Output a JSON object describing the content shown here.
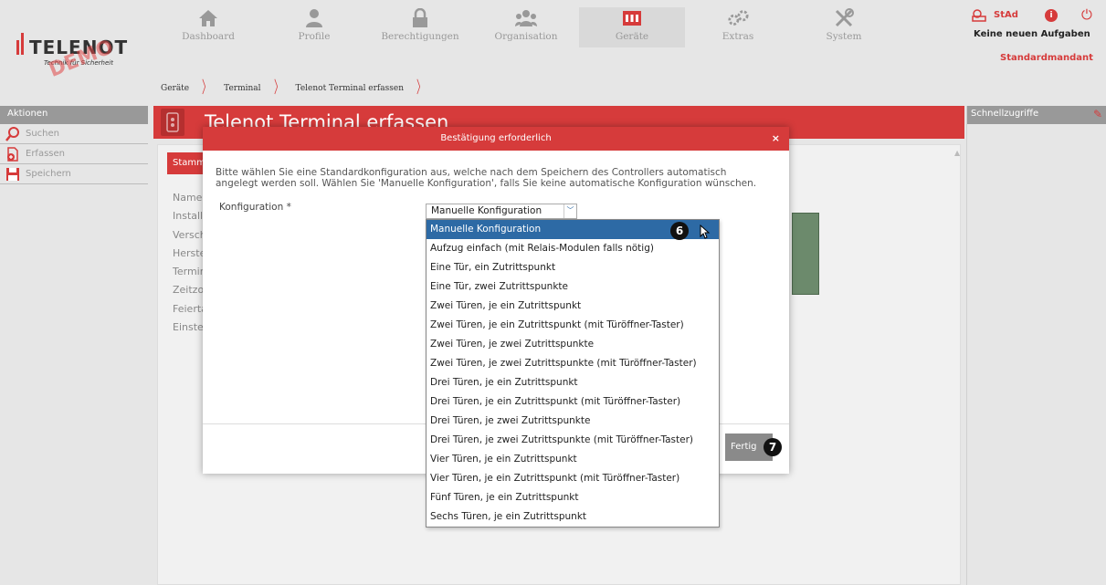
{
  "header": {
    "logo_text": "TELENOT",
    "logo_tagline": "Technik für Sicherheit",
    "logo_watermark": "DEMO",
    "nav": [
      {
        "label": "Dashboard",
        "icon": "house-icon"
      },
      {
        "label": "Profile",
        "icon": "person-icon"
      },
      {
        "label": "Berechtigungen",
        "icon": "lock-icon"
      },
      {
        "label": "Organisation",
        "icon": "group-icon"
      },
      {
        "label": "Geräte",
        "icon": "device-icon",
        "active": true
      },
      {
        "label": "Extras",
        "icon": "gears-icon"
      },
      {
        "label": "System",
        "icon": "tools-icon"
      }
    ],
    "user": "StAd",
    "tasks": "Keine neuen Aufgaben",
    "mandant": "Standardmandant"
  },
  "breadcrumb": [
    "Geräte",
    "Terminal",
    "Telenot Terminal erfassen"
  ],
  "sidebar": {
    "title": "Aktionen",
    "items": [
      {
        "label": "Suchen",
        "icon": "search-icon"
      },
      {
        "label": "Erfassen",
        "icon": "add-document-icon"
      },
      {
        "label": "Speichern",
        "icon": "save-icon"
      }
    ]
  },
  "main": {
    "title": "Telenot Terminal erfassen",
    "tab": "Stamm",
    "fields": [
      "Name",
      "Installa",
      "Versch",
      "Herste",
      "Termir",
      "Zeitzo",
      "Feierta",
      "Einstel"
    ]
  },
  "quick": {
    "title": "Schnellzugriffe"
  },
  "modal": {
    "title": "Bestätigung erforderlich",
    "close": "×",
    "message": "Bitte wählen Sie eine Standardkonfiguration aus, welche nach dem Speichern des Controllers automatisch angelegt werden soll. Wählen Sie 'Manuelle Konfiguration', falls Sie keine automatische Konfiguration wünschen.",
    "config_label": "Konfiguration *",
    "config_value": "Manuelle Konfiguration",
    "done_button": "Fertig"
  },
  "dropdown": {
    "options": [
      "Manuelle Konfiguration",
      "Aufzug einfach (mit Relais-Modulen falls nötig)",
      "Eine Tür, ein Zutrittspunkt",
      "Eine Tür, zwei Zutrittspunkte",
      "Zwei Türen, je ein Zutrittspunkt",
      "Zwei Türen, je ein Zutrittspunkt (mit Türöffner-Taster)",
      "Zwei Türen, je zwei Zutrittspunkte",
      "Zwei Türen, je zwei Zutrittspunkte (mit Türöffner-Taster)",
      "Drei Türen, je ein Zutrittspunkt",
      "Drei Türen, je ein Zutrittspunkt (mit Türöffner-Taster)",
      "Drei Türen, je zwei Zutrittspunkte",
      "Drei Türen, je zwei Zutrittspunkte (mit Türöffner-Taster)",
      "Vier Türen, je ein Zutrittspunkt",
      "Vier Türen, je ein Zutrittspunkt (mit Türöffner-Taster)",
      "Fünf Türen, je ein Zutrittspunkt",
      "Sechs Türen, je ein Zutrittspunkt"
    ],
    "selected_index": 0
  },
  "annotations": {
    "badge_select": "6",
    "badge_done": "7"
  },
  "colors": {
    "accent": "#d63b3b",
    "selection": "#2d6aa5",
    "background": "#e6e6e6"
  }
}
